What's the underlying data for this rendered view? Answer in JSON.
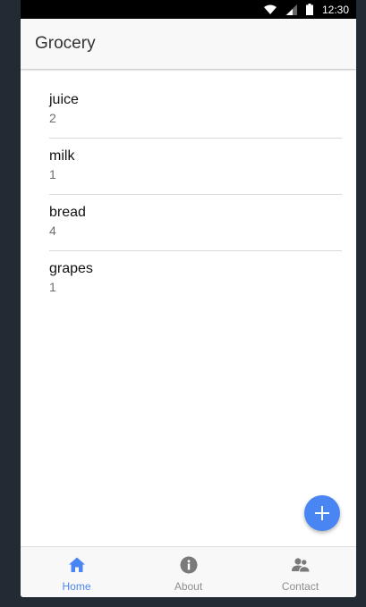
{
  "status_bar": {
    "time": "12:30",
    "icons": [
      "wifi-icon",
      "signal-icon",
      "battery-icon"
    ]
  },
  "app_bar": {
    "title": "Grocery"
  },
  "grocery_list": [
    {
      "name": "juice",
      "quantity": "2"
    },
    {
      "name": "milk",
      "quantity": "1"
    },
    {
      "name": "bread",
      "quantity": "4"
    },
    {
      "name": "grapes",
      "quantity": "1"
    }
  ],
  "fab": {
    "icon": "plus-icon"
  },
  "tabs": [
    {
      "label": "Home",
      "icon": "home-icon",
      "active": true
    },
    {
      "label": "About",
      "icon": "info-icon",
      "active": false
    },
    {
      "label": "Contact",
      "icon": "contacts-icon",
      "active": false
    }
  ],
  "colors": {
    "accent": "#4a86f3",
    "inactive": "#8e8e8e",
    "app_bar_bg": "#f8f8f8",
    "status_bar_bg": "#000000"
  }
}
